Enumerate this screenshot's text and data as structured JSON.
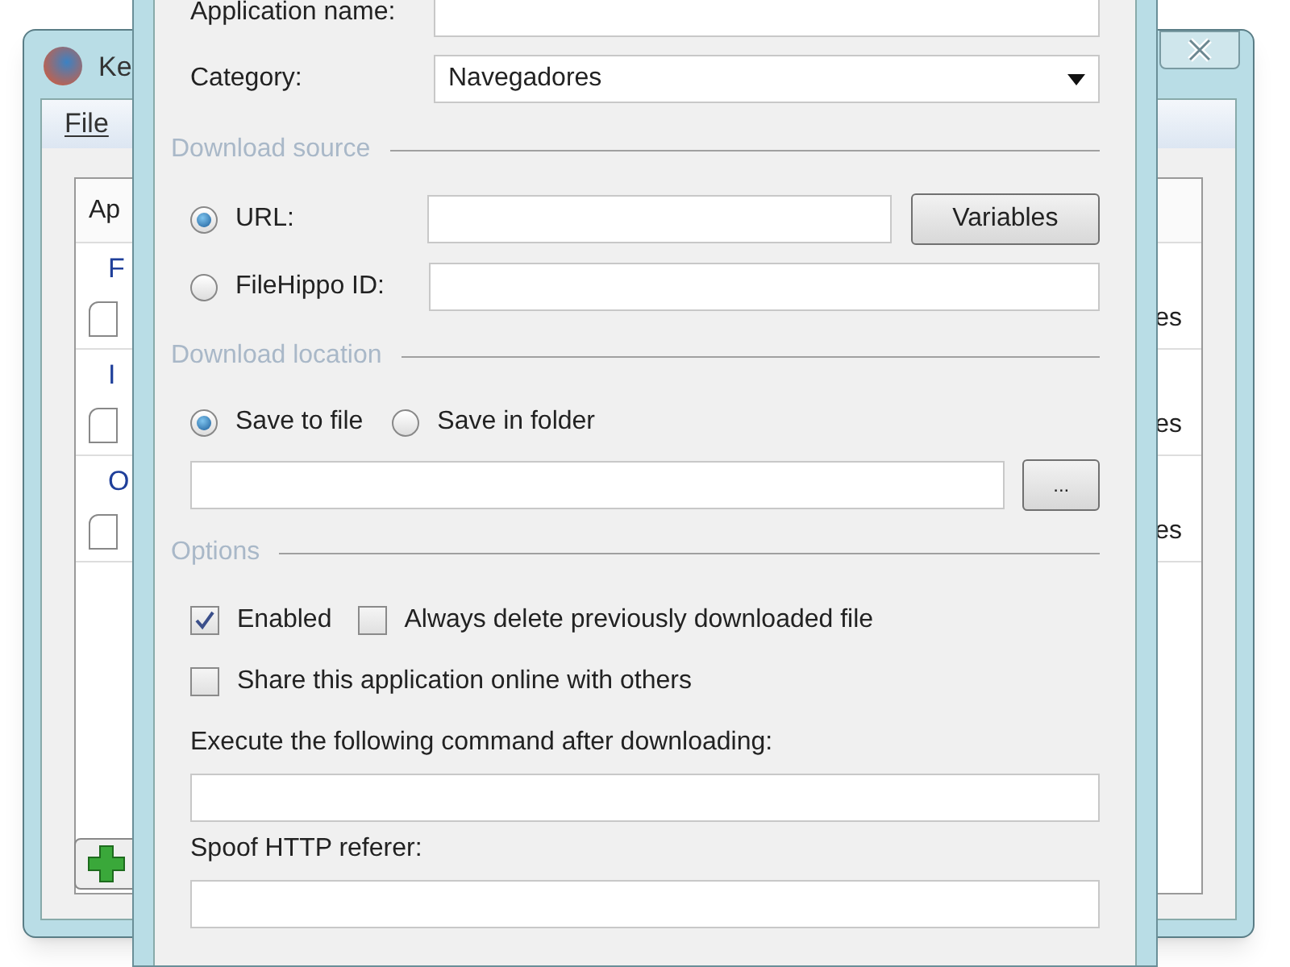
{
  "background_window": {
    "title": "Ke",
    "menu": [
      "File"
    ],
    "list_header": "Ap",
    "groups": [
      {
        "label": "F",
        "items": [
          {
            "column_3": "es"
          }
        ]
      },
      {
        "label": "I",
        "items": [
          {
            "column_3": "es"
          }
        ]
      },
      {
        "label": "O",
        "items": [
          {
            "column_3": "es"
          }
        ]
      }
    ]
  },
  "dialog": {
    "application_name": {
      "label": "Application name:"
    },
    "category": {
      "label": "Category:",
      "value": "Navegadores"
    },
    "download_source": {
      "title": "Download source",
      "options": [
        {
          "label": "URL:",
          "selected": true
        },
        {
          "label": "FileHippo ID:",
          "selected": false
        }
      ],
      "variables_button": "Variables"
    },
    "download_location": {
      "title": "Download location",
      "options": [
        {
          "label": "Save to file",
          "selected": true
        },
        {
          "label": "Save in folder",
          "selected": false
        }
      ],
      "browse_button": "..."
    },
    "options": {
      "title": "Options",
      "checkboxes": [
        {
          "label": "Enabled",
          "checked": true
        },
        {
          "label": "Always delete previously downloaded file",
          "checked": false
        },
        {
          "label": "Share this application online with others",
          "checked": false
        }
      ],
      "command_label": "Execute the following command after downloading:",
      "referer_label": "Spoof HTTP referer:"
    }
  }
}
